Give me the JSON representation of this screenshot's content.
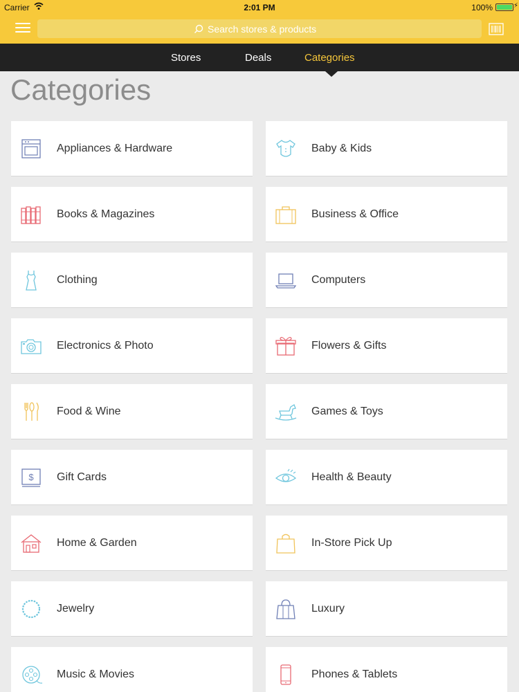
{
  "status_bar": {
    "carrier": "Carrier",
    "time": "2:01 PM",
    "battery": "100%"
  },
  "header": {
    "search_placeholder": "Search stores & products",
    "brand_color": "#f7c93a"
  },
  "tabs": [
    {
      "label": "Stores",
      "active": false
    },
    {
      "label": "Deals",
      "active": false
    },
    {
      "label": "Categories",
      "active": true
    }
  ],
  "page_title": "Categories",
  "categories": [
    {
      "label": "Appliances & Hardware",
      "icon": "oven-icon",
      "color": "#6f7fb5"
    },
    {
      "label": "Baby & Kids",
      "icon": "onesie-icon",
      "color": "#6fc6dd"
    },
    {
      "label": "Books & Magazines",
      "icon": "books-icon",
      "color": "#e86a74"
    },
    {
      "label": "Business & Office",
      "icon": "briefcase-icon",
      "color": "#f0c35a"
    },
    {
      "label": "Clothing",
      "icon": "dress-icon",
      "color": "#6fc6dd"
    },
    {
      "label": "Computers",
      "icon": "laptop-icon",
      "color": "#6f7fb5"
    },
    {
      "label": "Electronics & Photo",
      "icon": "camera-icon",
      "color": "#6fc6dd"
    },
    {
      "label": "Flowers & Gifts",
      "icon": "gift-icon",
      "color": "#e86a74"
    },
    {
      "label": "Food & Wine",
      "icon": "cutlery-icon",
      "color": "#f0c35a"
    },
    {
      "label": "Games & Toys",
      "icon": "rocking-horse-icon",
      "color": "#6fc6dd"
    },
    {
      "label": "Gift Cards",
      "icon": "gift-card-icon",
      "color": "#6f7fb5"
    },
    {
      "label": "Health & Beauty",
      "icon": "eye-icon",
      "color": "#6fc6dd"
    },
    {
      "label": "Home & Garden",
      "icon": "house-icon",
      "color": "#e86a74"
    },
    {
      "label": "In-Store Pick Up",
      "icon": "shopping-bag-icon",
      "color": "#f0c35a"
    },
    {
      "label": "Jewelry",
      "icon": "necklace-icon",
      "color": "#6fc6dd"
    },
    {
      "label": "Luxury",
      "icon": "luxury-bag-icon",
      "color": "#6f7fb5"
    },
    {
      "label": "Music & Movies",
      "icon": "film-reel-icon",
      "color": "#6fc6dd"
    },
    {
      "label": "Phones & Tablets",
      "icon": "phone-icon",
      "color": "#e86a74"
    }
  ]
}
